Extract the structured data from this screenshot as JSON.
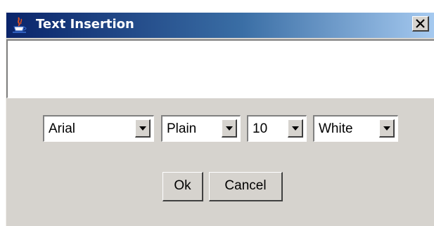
{
  "window": {
    "title": "Text Insertion",
    "icon": "java-cup-icon"
  },
  "title_bar": {
    "close_icon": "close-icon"
  },
  "text_input": {
    "value": ""
  },
  "controls": {
    "font_family": "Arial",
    "font_style": "Plain",
    "font_size": "10",
    "color": "White"
  },
  "buttons": {
    "ok_label": "Ok",
    "cancel_label": "Cancel"
  },
  "colors": {
    "title_bar_start": "#0a246a",
    "title_bar_end": "#a6caf0",
    "dialog_background": "#d6d3ce"
  }
}
